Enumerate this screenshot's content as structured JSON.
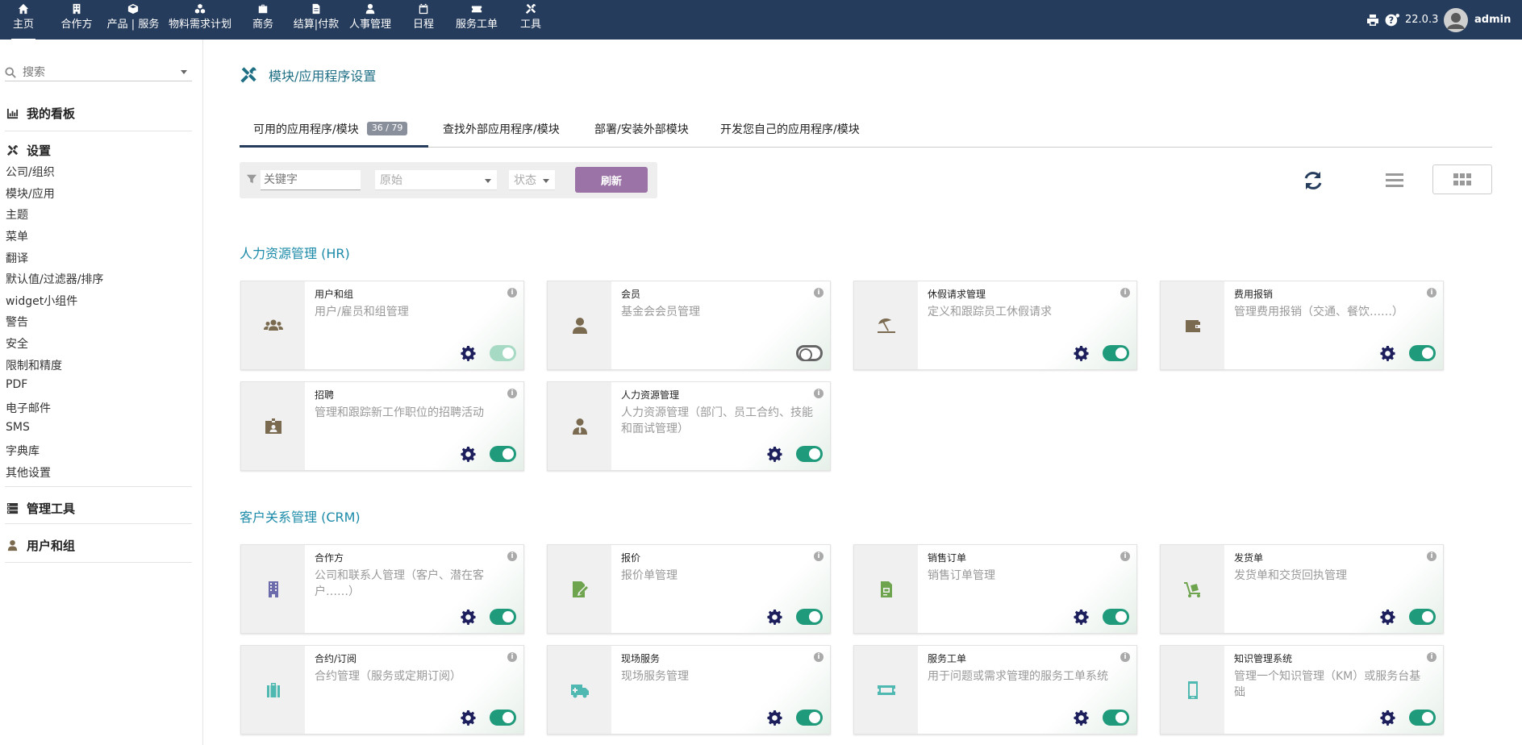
{
  "topbar": {
    "nav": [
      {
        "label": "主页",
        "icon": "home-icon"
      },
      {
        "label": "合作方",
        "icon": "building-icon"
      },
      {
        "label": "产品 | 服务",
        "icon": "cube-icon"
      },
      {
        "label": "物料需求计划",
        "icon": "cubes-icon"
      },
      {
        "label": "商务",
        "icon": "briefcase-icon"
      },
      {
        "label": "结算|付款",
        "icon": "file-invoice-icon"
      },
      {
        "label": "人事管理",
        "icon": "user-tie-icon"
      },
      {
        "label": "日程",
        "icon": "calendar-icon"
      },
      {
        "label": "服务工单",
        "icon": "ticket-icon"
      },
      {
        "label": "工具",
        "icon": "tools-icon"
      }
    ],
    "version": "22.0.3",
    "user": "admin",
    "bg_color": "#263c5c"
  },
  "sidebar": {
    "search_placeholder": "搜索",
    "dashboard_label": "我的看板",
    "settings_label": "设置",
    "settings_links": [
      "公司/组织",
      "模块/应用",
      "主题",
      "菜单",
      "翻译",
      "默认值/过滤器/排序",
      "widget小组件",
      "警告",
      "安全",
      "限制和精度",
      "PDF",
      "电子邮件",
      "SMS",
      "字典库",
      "其他设置"
    ],
    "admin_tools_label": "管理工具",
    "users_groups_label": "用户和组"
  },
  "main": {
    "title": "模块/应用程序设置",
    "tabs": [
      {
        "label": "可用的应用程序/模块",
        "badge": "36 / 79"
      },
      {
        "label": "查找外部应用程序/模块"
      },
      {
        "label": "部署/安装外部模块"
      },
      {
        "label": "开发您自己的应用程序/模块"
      }
    ],
    "filter": {
      "keyword_placeholder": "关键字",
      "origin_placeholder": "原始",
      "status_placeholder": "状态",
      "refresh_label": "刷新"
    },
    "sections": [
      {
        "title": "人力资源管理 (HR)",
        "cards": [
          {
            "title": "用户和组",
            "desc": "用户/雇员和组管理",
            "icon": "users-icon",
            "icon_color": "#7a6a4f",
            "state": "dim",
            "gear": true
          },
          {
            "title": "会员",
            "desc": "基金会会员管理",
            "icon": "user-icon",
            "icon_color": "#7a6a4f",
            "state": "off",
            "gear": false
          },
          {
            "title": "休假请求管理",
            "desc": "定义和跟踪员工休假请求",
            "icon": "umbrella-beach-icon",
            "icon_color": "#7a6a4f",
            "state": "on",
            "gear": true
          },
          {
            "title": "费用报销",
            "desc": "管理费用报销（交通、餐饮……）",
            "icon": "wallet-icon",
            "icon_color": "#7a6a4f",
            "state": "on",
            "gear": true
          },
          {
            "title": "招聘",
            "desc": "管理和跟踪新工作职位的招聘活动",
            "icon": "id-badge-icon",
            "icon_color": "#7a6a4f",
            "state": "on",
            "gear": true
          },
          {
            "title": "人力资源管理",
            "desc": "人力资源管理（部门、员工合约、技能和面试管理）",
            "icon": "user-tie-icon",
            "icon_color": "#7a6a4f",
            "state": "on",
            "gear": true
          }
        ]
      },
      {
        "title": "客户关系管理 (CRM)",
        "cards": [
          {
            "title": "合作方",
            "desc": "公司和联系人管理（客户、潜在客户……）",
            "icon": "building-icon",
            "icon_color": "#6c6cad",
            "state": "on",
            "gear": true
          },
          {
            "title": "报价",
            "desc": "报价单管理",
            "icon": "file-signature-icon",
            "icon_color": "#6fa44f",
            "state": "on",
            "gear": true
          },
          {
            "title": "销售订单",
            "desc": "销售订单管理",
            "icon": "file-invoice-icon",
            "icon_color": "#6fa44f",
            "state": "on",
            "gear": true
          },
          {
            "title": "发货单",
            "desc": "发货单和交货回执管理",
            "icon": "dolly-icon",
            "icon_color": "#6fa44f",
            "state": "on",
            "gear": true
          },
          {
            "title": "合约/订阅",
            "desc": "合约管理（服务或定期订阅）",
            "icon": "suitcase-icon",
            "icon_color": "#4fb8b0",
            "state": "on",
            "gear": true
          },
          {
            "title": "现场服务",
            "desc": "现场服务管理",
            "icon": "ambulance-icon",
            "icon_color": "#4fb8b0",
            "state": "on",
            "gear": true
          },
          {
            "title": "服务工单",
            "desc": "用于问题或需求管理的服务工单系统",
            "icon": "ticket-icon",
            "icon_color": "#4fb8b0",
            "state": "on",
            "gear": true
          },
          {
            "title": "知识管理系统",
            "desc": "管理一个知识管理（KM）或服务台基础",
            "icon": "mobile-icon",
            "icon_color": "#4fb8b0",
            "state": "on",
            "gear": true
          }
        ]
      }
    ]
  }
}
